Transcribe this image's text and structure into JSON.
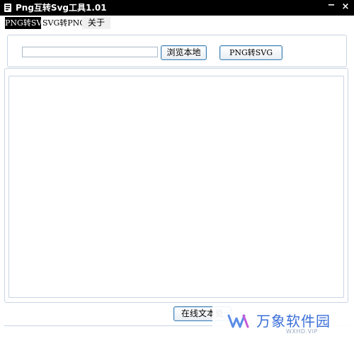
{
  "window": {
    "title": "Png互转Svg工具1.01",
    "minimize_glyph": "−",
    "close_glyph": "×"
  },
  "tabs": [
    {
      "label": "PNG转SVG",
      "selected": true
    },
    {
      "label": "SVG转PNG",
      "selected": false
    },
    {
      "label": "关于",
      "selected": false
    }
  ],
  "toolbar": {
    "path_value": "",
    "browse_label": "浏览本地",
    "convert_label": "PNG转SVG"
  },
  "bottom": {
    "online_label": "在线文本处"
  },
  "watermark": {
    "brand": "万象软件园",
    "sub": "WXHD.VIP"
  },
  "colors": {
    "titlebar": "#000000",
    "border": "#c9d4e3",
    "button_border": "#3c7fb1",
    "watermark": "#3b6fd8"
  },
  "icons": {
    "app": "app-icon",
    "minimize": "minimize-icon",
    "close": "close-icon",
    "watermark_logo": "wm-logo-icon"
  }
}
